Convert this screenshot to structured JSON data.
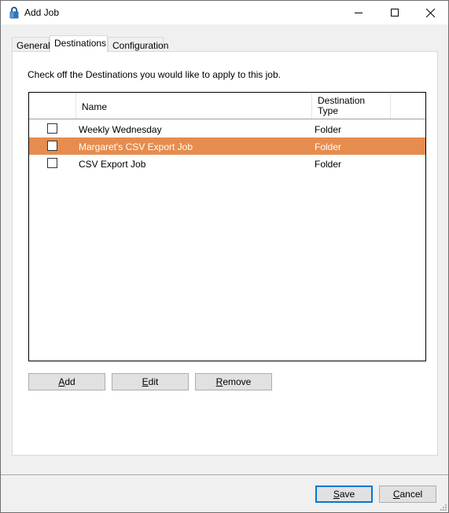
{
  "window": {
    "title": "Add Job",
    "app_icon": "padlock-icon",
    "controls": {
      "minimize": "minimize-icon",
      "maximize": "maximize-icon",
      "close": "close-icon"
    }
  },
  "tabs": [
    {
      "label": "General",
      "active": false
    },
    {
      "label": "Destinations",
      "active": true
    },
    {
      "label": "Configuration",
      "active": false
    }
  ],
  "destinations": {
    "instruction": "Check off the Destinations you would like to apply to this job.",
    "columns": {
      "name": "Name",
      "type_line1": "Destination",
      "type_line2": "Type"
    },
    "rows": [
      {
        "name": "Weekly Wednesday",
        "type": "Folder",
        "checked": false,
        "selected": false
      },
      {
        "name": "Margaret's CSV Export Job",
        "type": "Folder",
        "checked": false,
        "selected": true
      },
      {
        "name": "CSV Export Job",
        "type": "Folder",
        "checked": false,
        "selected": false
      }
    ],
    "buttons": {
      "add": {
        "accel": "A",
        "rest": "dd"
      },
      "edit": {
        "accel": "E",
        "rest": "dit"
      },
      "remove": {
        "accel": "R",
        "rest": "emove"
      }
    }
  },
  "footer": {
    "save": {
      "accel": "S",
      "rest": "ave"
    },
    "cancel": {
      "accel": "C",
      "rest": "ancel"
    }
  },
  "colors": {
    "selection": "#e68c4e",
    "default_button_border": "#0078d7"
  }
}
